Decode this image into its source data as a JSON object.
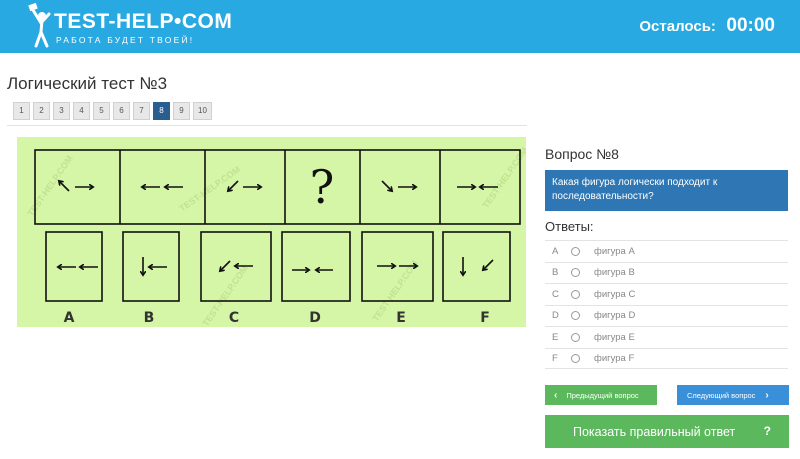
{
  "header": {
    "logo_main": "TEST-HELP•COM",
    "logo_sub": "РАБОТА БУДЕТ ТВОЕЙ!",
    "timer_label": "Осталось:",
    "timer_value": "00:00"
  },
  "test": {
    "title": "Логический тест №3",
    "pages": [
      "1",
      "2",
      "3",
      "4",
      "5",
      "6",
      "7",
      "8",
      "9",
      "10"
    ],
    "current_page": "8"
  },
  "puzzle": {
    "background": "#d5f6a6",
    "watermark": "TEST-HELP.COM",
    "sequence": [
      {
        "icon": "up-left-and-right-arrows-icon"
      },
      {
        "icon": "left-left-arrows-icon"
      },
      {
        "icon": "down-left-and-right-arrows-icon"
      },
      {
        "icon": "question-mark",
        "text": "?"
      },
      {
        "icon": "down-right-and-right-arrows-icon"
      },
      {
        "icon": "right-and-left-arrows-icon"
      }
    ],
    "options": [
      {
        "label": "A",
        "icon": "left-left-arrows-icon"
      },
      {
        "label": "B",
        "icon": "down-and-left-arrows-icon"
      },
      {
        "label": "C",
        "icon": "down-left-and-left-arrows-icon"
      },
      {
        "label": "D",
        "icon": "right-and-left-arrows-icon"
      },
      {
        "label": "E",
        "icon": "right-right-arrows-icon"
      },
      {
        "label": "F",
        "icon": "down-and-down-left-arrows-icon"
      }
    ]
  },
  "question": {
    "title": "Вопрос №8",
    "text": "Какая фигура логически подходит к последовательности?"
  },
  "answers": {
    "title": "Ответы:",
    "items": [
      {
        "letter": "A",
        "label": "фигура А"
      },
      {
        "letter": "B",
        "label": "фигура B"
      },
      {
        "letter": "C",
        "label": "фигура C"
      },
      {
        "letter": "D",
        "label": "фигура D"
      },
      {
        "letter": "E",
        "label": "фигура E"
      },
      {
        "letter": "F",
        "label": "фигура F"
      }
    ]
  },
  "buttons": {
    "prev": "Предыдущий вопрос",
    "next": "Следующий вопрос",
    "show_answer": "Показать правильный ответ",
    "help": "?"
  },
  "colors": {
    "header": "#29a9e1",
    "active_page": "#2a5e91",
    "question_box": "#2e77b4",
    "green_button": "#5cb85c",
    "blue_button": "#3a8fd9"
  }
}
